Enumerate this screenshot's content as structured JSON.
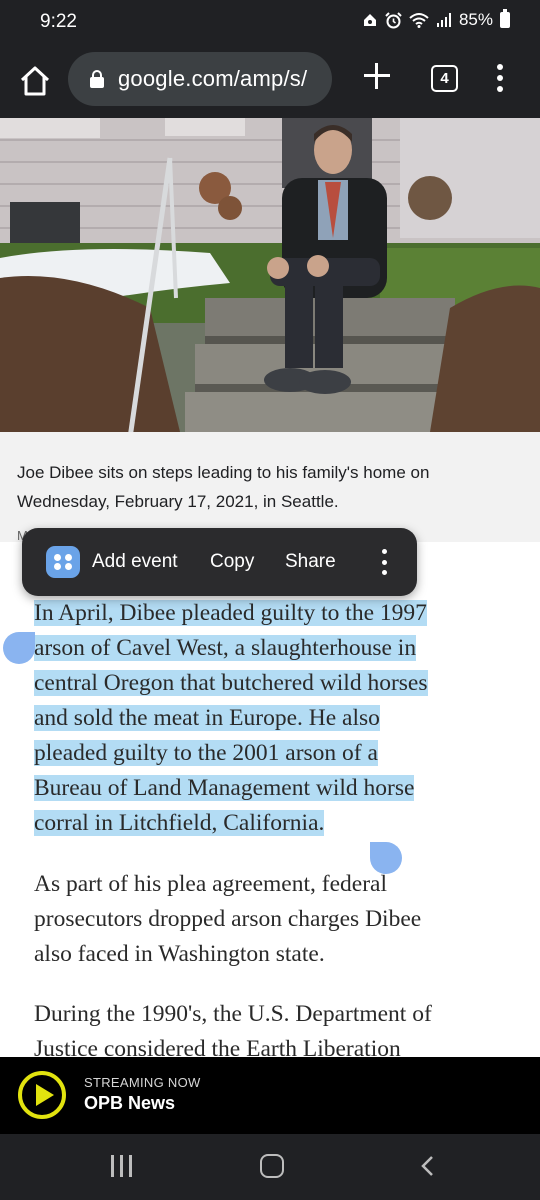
{
  "status_bar": {
    "time": "9:22",
    "battery": "85%",
    "icons": [
      "home-status-icon",
      "alarm-icon",
      "wifi-icon",
      "signal-icon",
      "battery-icon"
    ]
  },
  "browser": {
    "url": "google.com/amp/s/",
    "tab_count": "4",
    "icons": [
      "home-icon",
      "lock-icon",
      "new-tab-icon",
      "tab-switcher-icon",
      "more-vert-icon"
    ]
  },
  "article": {
    "photo_caption": "Joe Dibee sits on steps leading to his family's home on Wednesday, February 17, 2021, in Seattle.",
    "credit_stub": "M",
    "paragraphs": [
      {
        "lines": [
          "In April, Dibee pleaded guilty to the 1997",
          "arson of Cavel West, a slaughterhouse in",
          "central Oregon that butchered wild horses",
          "and sold the meat in Europe. He also",
          "pleaded guilty to the 2001 arson of a",
          "Bureau of Land Management wild horse",
          "corral in Litchfield, California."
        ]
      },
      {
        "lines": [
          "As part of his plea agreement, federal",
          "prosecutors dropped arson charges Dibee",
          "also faced in Washington state."
        ]
      },
      {
        "lines": [
          "During the 1990's, the U.S. Department of",
          "Justice considered the Earth Liberation"
        ]
      }
    ]
  },
  "selection_popup": {
    "app_icon": "samsung-calendar-icon",
    "items": [
      "Add event",
      "Copy",
      "Share"
    ]
  },
  "streaming": {
    "label": "STREAMING NOW",
    "station": "OPB News",
    "accent": "#e2e30f"
  },
  "nav_bar": {
    "icons": [
      "recents-icon",
      "home-nav-icon",
      "back-icon"
    ]
  },
  "colors": {
    "toolbar_bg": "#202124",
    "selection": "#b3dcf4",
    "handle": "#8ab4f0"
  }
}
